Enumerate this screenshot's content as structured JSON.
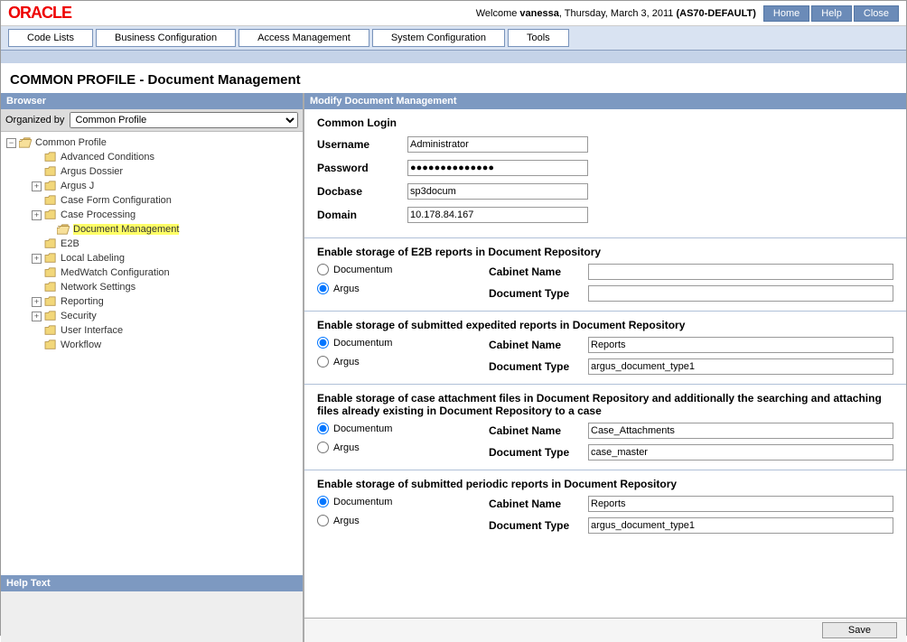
{
  "header": {
    "logo": "ORACLE",
    "welcome_prefix": "Welcome ",
    "username": "vanessa",
    "welcome_suffix": ", Thursday, March 3, 2011 ",
    "context": "(AS70-DEFAULT)",
    "buttons": {
      "home": "Home",
      "help": "Help",
      "close": "Close"
    }
  },
  "nav": {
    "codeLists": "Code Lists",
    "businessConfig": "Business Configuration",
    "accessMgmt": "Access Management",
    "systemConfig": "System Configuration",
    "tools": "Tools"
  },
  "page_title": "COMMON PROFILE - Document Management",
  "browser": {
    "header": "Browser",
    "organized_label": "Organized by",
    "organized_value": "Common Profile",
    "help_header": "Help Text",
    "tree": {
      "root": "Common Profile",
      "items": [
        "Advanced Conditions",
        "Argus Dossier",
        "Argus J",
        "Case Form Configuration",
        "Case Processing",
        "Document Management",
        "E2B",
        "Local Labeling",
        "MedWatch Configuration",
        "Network Settings",
        "Reporting",
        "Security",
        "User Interface",
        "Workflow"
      ]
    }
  },
  "main": {
    "header": "Modify Document Management",
    "login": {
      "title": "Common Login",
      "username_label": "Username",
      "username": "Administrator",
      "password_label": "Password",
      "password": "●●●●●●●●●●●●●●",
      "docbase_label": "Docbase",
      "docbase": "sp3docum",
      "domain_label": "Domain",
      "domain": "10.178.84.167"
    },
    "radio": {
      "documentum": "Documentum",
      "argus": "Argus"
    },
    "labels": {
      "cabinet": "Cabinet Name",
      "doctype": "Document Type"
    },
    "sections": [
      {
        "title": "Enable storage of E2B reports in Document Repository",
        "selected": "argus",
        "cabinet": "",
        "doctype": ""
      },
      {
        "title": "Enable storage of submitted expedited reports in Document Repository",
        "selected": "documentum",
        "cabinet": "Reports",
        "doctype": "argus_document_type1"
      },
      {
        "title": "Enable storage of case attachment files in Document Repository and additionally the searching and attaching files already existing in Document Repository to a case",
        "selected": "documentum",
        "cabinet": "Case_Attachments",
        "doctype": "case_master"
      },
      {
        "title": "Enable storage of submitted periodic reports in Document Repository",
        "selected": "documentum",
        "cabinet": "Reports",
        "doctype": "argus_document_type1"
      }
    ],
    "save": "Save"
  }
}
